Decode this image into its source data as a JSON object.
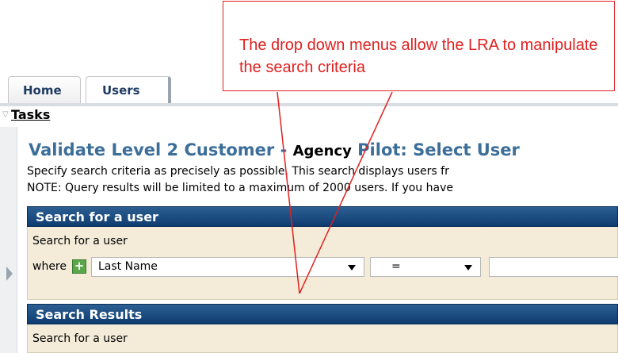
{
  "tabs": [
    {
      "label": "Home"
    },
    {
      "label": "Users"
    }
  ],
  "tasks": {
    "label": "Tasks"
  },
  "page": {
    "title": "Validate Level 2 Customer",
    "title_sep": " - ",
    "title_agency": "Agency",
    "title_suffix": " Pilot: Select User",
    "desc_line1": "Specify search criteria as precisely as possible. This search displays users fr",
    "desc_line2": "NOTE: Query results will be limited to a maximum of 2000 users. If you have"
  },
  "search_panel": {
    "header": "Search for a user",
    "label": "Search for a user",
    "where_label": "where",
    "add_symbol": "+",
    "field_value": "Last Name",
    "operator_value": "=",
    "value_input": ""
  },
  "results_panel": {
    "header": "Search Results",
    "text": "Search for a user"
  },
  "callout": {
    "text": "The drop down menus allow the LRA to manipulate the search criteria",
    "color": "#e12020"
  },
  "colors": {
    "panel_header": "#1f4f82",
    "panel_body": "#f4ecd9",
    "title": "#3c6e9a",
    "add_button": "#5aa64a"
  }
}
